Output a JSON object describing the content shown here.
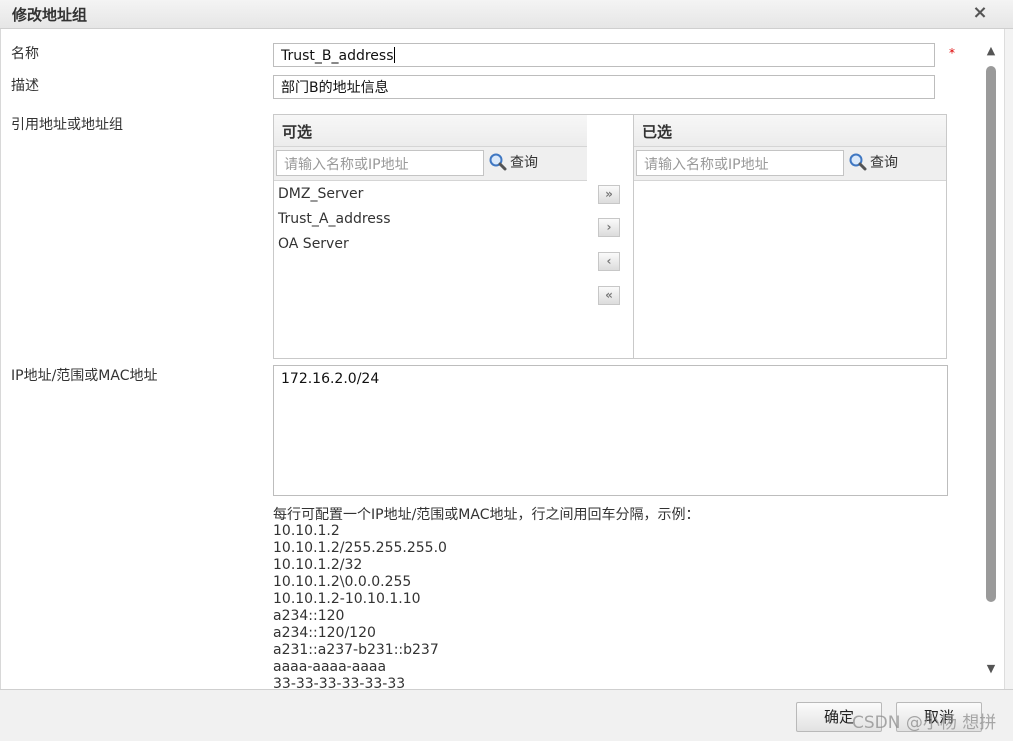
{
  "dialog": {
    "title": "修改地址组",
    "close_glyph": "×"
  },
  "form": {
    "name_label": "名称",
    "name_value": "Trust_B_address",
    "required_mark": "*",
    "desc_label": "描述",
    "desc_value": "部门B的地址信息",
    "ref_label": "引用地址或地址组",
    "ip_label": "IP地址/范围或MAC地址",
    "ip_value": "172.16.2.0/24"
  },
  "available": {
    "header": "可选",
    "search_placeholder": "请输入名称或IP地址",
    "search_label": "查询",
    "items": [
      "DMZ_Server",
      "Trust_A_address",
      "OA Server"
    ]
  },
  "selected": {
    "header": "已选",
    "search_placeholder": "请输入名称或IP地址",
    "search_label": "查询"
  },
  "transfer": {
    "add_all": "»",
    "add": "›",
    "remove": "‹",
    "remove_all": "«"
  },
  "hint": {
    "title": "每行可配置一个IP地址/范围或MAC地址，行之间用回车分隔，示例：",
    "examples": [
      "10.10.1.2",
      "10.10.1.2/255.255.255.0",
      "10.10.1.2/32",
      "10.10.1.2\\0.0.0.255",
      "10.10.1.2-10.10.1.10",
      "a234::120",
      "a234::120/120",
      "a231::a237-b231::b237",
      "aaaa-aaaa-aaaa",
      "33-33-33-33-33-33"
    ]
  },
  "footer": {
    "ok_label": "确定",
    "cancel_label": "取消"
  },
  "watermark": "CSDN @小杨 想拼",
  "colors": {
    "required": "#dd0000",
    "scroll_thumb": "#9a9a9a"
  }
}
